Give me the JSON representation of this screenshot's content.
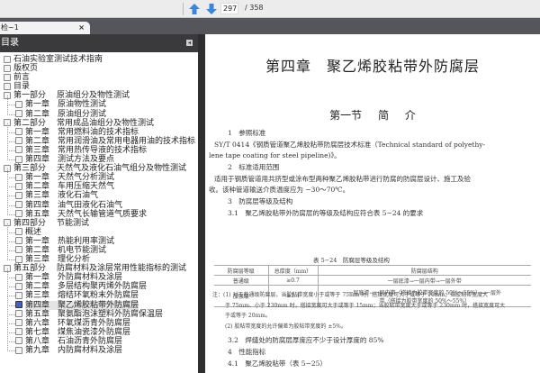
{
  "toolbar": {
    "current_page": "297",
    "total_pages": "/ 358",
    "prev_icon": "arrow-up-icon",
    "next_icon": "arrow-down-icon"
  },
  "tab": {
    "label": "检~1",
    "close": "×"
  },
  "toc": {
    "title": "目录",
    "collapse": "◂",
    "items": [
      {
        "level": 0,
        "num": "",
        "label": "石油实验室测试技术指南"
      },
      {
        "level": 0,
        "num": "",
        "label": "版权页"
      },
      {
        "level": 0,
        "num": "",
        "label": "前言"
      },
      {
        "level": 0,
        "num": "",
        "label": "目录"
      },
      {
        "level": 0,
        "num": "第一部分",
        "label": "原油组分及物性测试"
      },
      {
        "level": 1,
        "num": "第一章",
        "label": "原油物性测试"
      },
      {
        "level": 1,
        "num": "第二章",
        "label": "原油组分测试"
      },
      {
        "level": 0,
        "num": "第二部分",
        "label": "常用成品油组分及物性测试"
      },
      {
        "level": 1,
        "num": "第一章",
        "label": "常用燃料油的技术指标"
      },
      {
        "level": 1,
        "num": "第二章",
        "label": "常用润滑油及常用电器用油的技术指标"
      },
      {
        "level": 1,
        "num": "第三章",
        "label": "常用热传导液的技术指标"
      },
      {
        "level": 1,
        "num": "第四章",
        "label": "测试方法及要点"
      },
      {
        "level": 0,
        "num": "第三部分",
        "label": "天然气及液化石油气组分及物性测试"
      },
      {
        "level": 1,
        "num": "第一章",
        "label": "天然气分析测试"
      },
      {
        "level": 1,
        "num": "第二章",
        "label": "车用压缩天然气"
      },
      {
        "level": 1,
        "num": "第三章",
        "label": "液化石油气"
      },
      {
        "level": 1,
        "num": "第四章",
        "label": "油气田液化石油气"
      },
      {
        "level": 1,
        "num": "第五章",
        "label": "天然气长输管道气质要求"
      },
      {
        "level": 0,
        "num": "第四部分",
        "label": "节能测试"
      },
      {
        "level": 1,
        "num": "",
        "label": "概述"
      },
      {
        "level": 1,
        "num": "第一章",
        "label": "热能利用率测试"
      },
      {
        "level": 1,
        "num": "第二章",
        "label": "机电节能测试"
      },
      {
        "level": 1,
        "num": "第三章",
        "label": "理化分析"
      },
      {
        "level": 0,
        "num": "第五部分",
        "label": "防腐材料及涂层常用性能指标的测试"
      },
      {
        "level": 1,
        "num": "第一章",
        "label": "外防腐材料及涂层"
      },
      {
        "level": 1,
        "num": "第二章",
        "label": "多层结构聚丙烯外防腐层"
      },
      {
        "level": 1,
        "num": "第三章",
        "label": "熔结环氧粉末外防腐层"
      },
      {
        "level": 1,
        "num": "第四章",
        "label": "聚乙烯胶粘带外防腐层",
        "selected": true
      },
      {
        "level": 1,
        "num": "第五章",
        "label": "聚氨酯泡沫塑料外防腐保温层"
      },
      {
        "level": 1,
        "num": "第六章",
        "label": "环氧煤沥青外防腐层"
      },
      {
        "level": 1,
        "num": "第七章",
        "label": "煤焦油瓷漆外防腐层"
      },
      {
        "level": 1,
        "num": "第八章",
        "label": "石油沥青外防腐层"
      },
      {
        "level": 1,
        "num": "第九章",
        "label": "内防腐材料及涂层"
      }
    ]
  },
  "doc": {
    "chapter_title": "第四章　聚乙烯胶粘带外防腐层",
    "section_title": "第一节 简 介",
    "lines": [
      "1　参照标准",
      "SY/T 0414《钢质管道聚乙烯胶粘带防腐层技术标准（Technical standard of polyethy-",
      "lene tape coating for steel pipeline)》。",
      "2　标准适用范围",
      "适用于钢质管道用共挤型或涂布型两种聚乙烯胶粘带进行防腐的防腐层设计、施工及验",
      "收。该种管道输送介质温度应为 −30～70℃。",
      "3　防腐层等级及结构",
      "3.1　聚乙烯胶粘带外防腐层的等级及结构应符合表 5−24 的要求"
    ],
    "table_caption": "表 5−24　防腐层等级及结构",
    "table": {
      "headers": [
        "防腐层等级",
        "总厚度（mm）",
        "防腐层结构"
      ],
      "rows": [
        [
          "普通级",
          "≥0.7",
          "一层底漆→一层内带→一层外带"
        ],
        [
          "加强级",
          "≥1.4",
          "一层底漆→一层内带（搭接为胶带宽度的 50%～55%）→一层外带（搭接为胶带宽度的 50%～55%）"
        ]
      ]
    },
    "notes": [
      "注：(1) 对于普通级防腐层，当胶粘带宽度小于或等于 75mm 时，搭接宽度可大于或等于 10mm；当胶粘带宽度大",
      "于 75mm、小于 230mm 时，搭接宽度可大于或等于 15mm；当胶粘带宽度大于或等于 230mm 时，搭接宽度可大",
      "于或等于 20mm。",
      "(2) 胶粘带宽度的允许偏差为胶粘带宽度的 ±5%。"
    ],
    "lines2": [
      "3.2　焊缝处的防腐层厚度应不少于设计厚度的 85%",
      "4　性能指标",
      "4.1　聚乙烯胶粘带（表 5−25）"
    ]
  },
  "colors": {
    "toc_header": "#3a3a3c",
    "tabbar": "#55565b",
    "selected_checkbox": "#4a5dc8"
  }
}
